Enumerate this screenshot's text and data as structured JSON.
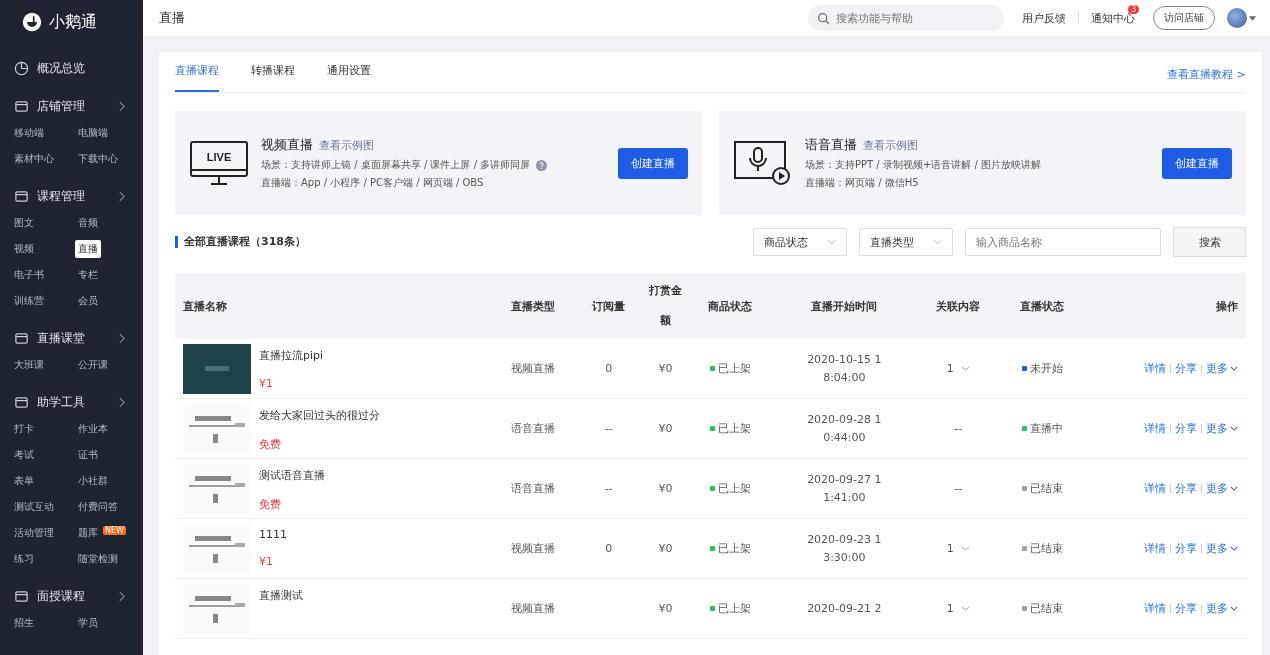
{
  "sidebar": {
    "logo": "小鹅通",
    "overview": "概况总览",
    "groups": [
      {
        "title": "店铺管理",
        "items": [
          {
            "label": "移动端",
            "selected": false
          },
          {
            "label": "电脑端",
            "selected": false
          },
          {
            "label": "素材中心",
            "selected": false
          },
          {
            "label": "下载中心",
            "selected": false
          }
        ]
      },
      {
        "title": "课程管理",
        "items": [
          {
            "label": "图文",
            "selected": false
          },
          {
            "label": "音频",
            "selected": false
          },
          {
            "label": "视频",
            "selected": false
          },
          {
            "label": "直播",
            "selected": true
          },
          {
            "label": "电子书",
            "selected": false
          },
          {
            "label": "专栏",
            "selected": false
          },
          {
            "label": "训练营",
            "selected": false
          },
          {
            "label": "会员",
            "selected": false
          }
        ]
      },
      {
        "title": "直播课堂",
        "items": [
          {
            "label": "大班课",
            "selected": false
          },
          {
            "label": "公开课",
            "selected": false
          }
        ]
      },
      {
        "title": "助学工具",
        "items": [
          {
            "label": "打卡",
            "selected": false
          },
          {
            "label": "作业本",
            "selected": false
          },
          {
            "label": "考试",
            "selected": false
          },
          {
            "label": "证书",
            "selected": false
          },
          {
            "label": "表单",
            "selected": false
          },
          {
            "label": "小社群",
            "selected": false
          },
          {
            "label": "测试互动",
            "selected": false
          },
          {
            "label": "付费问答",
            "selected": false
          },
          {
            "label": "活动管理",
            "selected": false
          },
          {
            "label": "题库",
            "selected": false,
            "badge": "NEW"
          },
          {
            "label": "练习",
            "selected": false
          },
          {
            "label": "随堂检测",
            "selected": false
          }
        ]
      },
      {
        "title": "面授课程",
        "items": [
          {
            "label": "招生",
            "selected": false
          },
          {
            "label": "学员",
            "selected": false
          }
        ]
      }
    ]
  },
  "header": {
    "title": "直播",
    "search": {
      "placeholder": "搜索功能与帮助"
    },
    "feedback": "用户反馈",
    "notifications": "通知中心",
    "notification_count": "3",
    "visit_store": "访问店铺"
  },
  "tabs": [
    {
      "label": "直播课程",
      "selected": true
    },
    {
      "label": "转播课程",
      "selected": false
    },
    {
      "label": "通用设置",
      "selected": false
    }
  ],
  "tutorial_link": "查看直播教程 >",
  "live_types": [
    {
      "kind": "video",
      "icon_text": "LIVE",
      "title": "视频直播",
      "example_link": "查看示例图",
      "scenes": "场景：支持讲师上镜 / 桌面屏幕共享 / 课件上屏 / 多讲师同屏",
      "help": true,
      "clients": "直播端：App / 小程序 / PC客户端 / 网页端 / OBS",
      "button": "创建直播"
    },
    {
      "kind": "audio",
      "title": "语音直播",
      "example_link": "查看示例图",
      "scenes": "场景：支持PPT / 录制视频+语音讲解 / 图片放映讲解",
      "help": false,
      "clients": "直播端：网页端 / 微信H5",
      "button": "创建直播"
    }
  ],
  "list_title": "全部直播课程（318条）",
  "filters": {
    "product_status": "商品状态",
    "live_type": "直播类型",
    "name": {
      "placeholder": "输入商品名称"
    },
    "search_button": "搜索"
  },
  "table": {
    "columns": [
      "直播名称",
      "直播类型",
      "订阅量",
      "打赏金额",
      "商品状态",
      "直播开始时间",
      "关联内容",
      "直播状态",
      "操作"
    ],
    "rows": [
      {
        "name": "直播拉流pipi",
        "price": "¥1",
        "type": "视频直播",
        "subscriptions": "0",
        "reward": "¥0",
        "product_status": "已上架",
        "start_time": "2020-10-15 18:04:00",
        "related": "1",
        "related_expandable": true,
        "live_status": "未开始",
        "color": "#1f5ce6",
        "actions": [
          "详情",
          "分享",
          "更多"
        ]
      },
      {
        "name": "发给大家回过头的很过分",
        "price": "免费",
        "type": "语音直播",
        "subscriptions": "--",
        "reward": "¥0",
        "product_status": "已上架",
        "start_time": "2020-09-28 10:44:00",
        "related": "--",
        "related_expandable": false,
        "live_status": "直播中",
        "color": "#22c55e",
        "actions": [
          "详情",
          "分享",
          "更多"
        ]
      },
      {
        "name": "测试语音直播",
        "price": "免费",
        "type": "语音直播",
        "subscriptions": "--",
        "reward": "¥0",
        "product_status": "已上架",
        "start_time": "2020-09-27 11:41:00",
        "related": "--",
        "related_expandable": false,
        "live_status": "已结束",
        "color": "#a0a4ab",
        "actions": [
          "详情",
          "分享",
          "更多"
        ]
      },
      {
        "name": "1111",
        "price": "¥1",
        "type": "视频直播",
        "subscriptions": "0",
        "reward": "¥0",
        "product_status": "已上架",
        "start_time": "2020-09-23 13:30:00",
        "related": "1",
        "related_expandable": true,
        "live_status": "已结束",
        "color": "#a0a4ab",
        "actions": [
          "详情",
          "分享",
          "更多"
        ]
      },
      {
        "name": "直播测试",
        "type": "视频直播",
        "reward": "¥0",
        "product_status": "已上架",
        "start_time": "2020-09-21 2",
        "related": "1",
        "related_expandable": true,
        "live_status": "已结束",
        "color": "#a0a4ab",
        "actions": [
          "详情",
          "分享",
          "更多"
        ]
      }
    ]
  }
}
